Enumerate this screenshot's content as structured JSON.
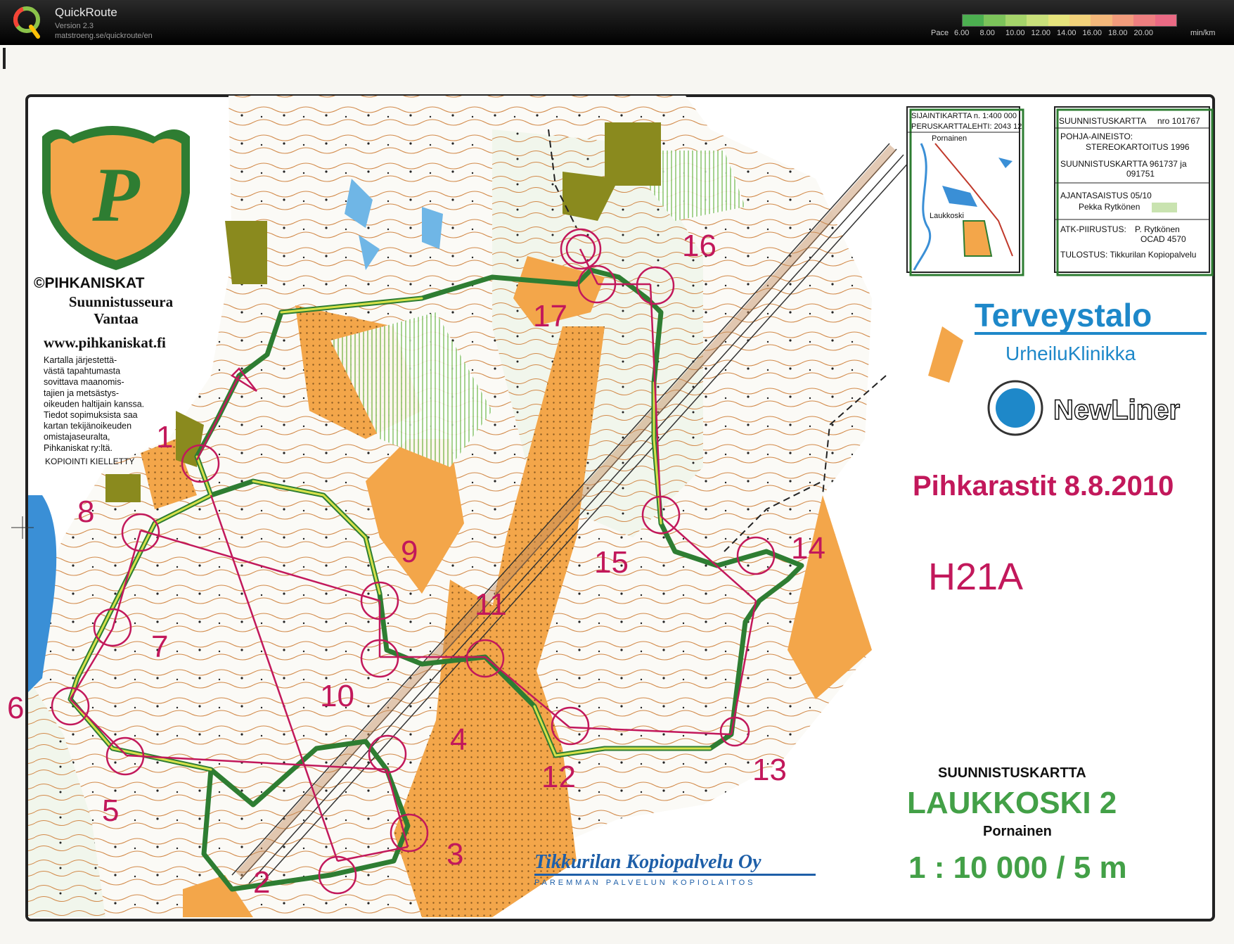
{
  "app": {
    "name": "QuickRoute",
    "version": "Version 2.3",
    "url": "matstroeng.se/quickroute/en"
  },
  "pace_legend": {
    "label": "Pace",
    "ticks": [
      "6.00",
      "8.00",
      "10.00",
      "12.00",
      "14.00",
      "16.00",
      "18.00",
      "20.00"
    ],
    "unit": "min/km",
    "gradient_colors": [
      "#4caf50",
      "#7cc35a",
      "#a5d46a",
      "#c9e07a",
      "#e6e47c",
      "#f2d27a",
      "#f4b87a",
      "#f29c7c",
      "#ee7f80",
      "#ea6a84"
    ]
  },
  "club": {
    "copyright": "©PIHKANISKAT",
    "name_line1": "Suunnistusseura",
    "name_line2": "Vantaa",
    "website": "www.pihkaniskat.fi",
    "notice_lines": [
      "Kartalla järjestettä-",
      "västä tapahtumasta",
      "sovittava maanomis-",
      "tajien ja metsästys-",
      "oikeuden haltijain kanssa.",
      "Tiedot sopimuksista saa",
      "kartan tekijänoikeuden",
      "omistajaseuralta,",
      "Pihkaniskat ry:ltä."
    ],
    "copy_forbidden": "KOPIOINTI KIELLETTY",
    "crest_letter": "P"
  },
  "location_map": {
    "line1": "SIJAINTIKARTTA  n. 1:400 000",
    "line2": "PERUSKARTTALEHTI: 2043 12",
    "place1": "Pornainen",
    "place2": "Laukkoski"
  },
  "map_info": {
    "title": "SUUNNISTUSKARTTA",
    "number": "nro 101767",
    "base_label": "POHJA-AINEISTO:",
    "base_value": "STEREOKARTOITUS 1996",
    "prior_maps_line1": "SUUNNISTUSKARTTA 961737 ja",
    "prior_maps_line2": "091751",
    "update_label": "AJANTASAISTUS 05/10",
    "update_person": "Pekka Rytkönen",
    "atk_label": "ATK-PIIRUSTUS:",
    "atk_person": "P. Rytkönen",
    "atk_software": "OCAD 4570",
    "print_label": "TULOSTUS: Tikkurilan Kopiopalvelu"
  },
  "sponsors": {
    "terveystalo": "Terveystalo",
    "urheiluklinikka": "UrheiluKlinikka",
    "newliner": "NewLiner",
    "tikkurila": "Tikkurilan Kopiopalvelu Oy",
    "tikkurila_sub": "PAREMMAN PALVELUN KOPIOLAITOS"
  },
  "event": {
    "title": "Pihkarastit 8.8.2010",
    "class": "H21A",
    "map_label": "SUUNNISTUSKARTTA",
    "map_name": "LAUKKOSKI 2",
    "municipality": "Pornainen",
    "scale": "1 : 10 000 / 5 m"
  },
  "controls": [
    {
      "label": "1"
    },
    {
      "label": "2"
    },
    {
      "label": "3"
    },
    {
      "label": "4"
    },
    {
      "label": "5"
    },
    {
      "label": "6"
    },
    {
      "label": "7"
    },
    {
      "label": "8"
    },
    {
      "label": "9"
    },
    {
      "label": "10"
    },
    {
      "label": "11"
    },
    {
      "label": "12"
    },
    {
      "label": "13"
    },
    {
      "label": "14"
    },
    {
      "label": "15"
    },
    {
      "label": "16"
    },
    {
      "label": "17"
    }
  ],
  "colors": {
    "course": "#c2185b",
    "route_slow": "#2e7d32",
    "route_fast": "#d7e24a",
    "terrain_open": "#f3a64a",
    "terrain_forest": "#ffffff",
    "contour": "#c87a3a",
    "water": "#3a8fd6",
    "green_veg": "#b9d8a0"
  }
}
